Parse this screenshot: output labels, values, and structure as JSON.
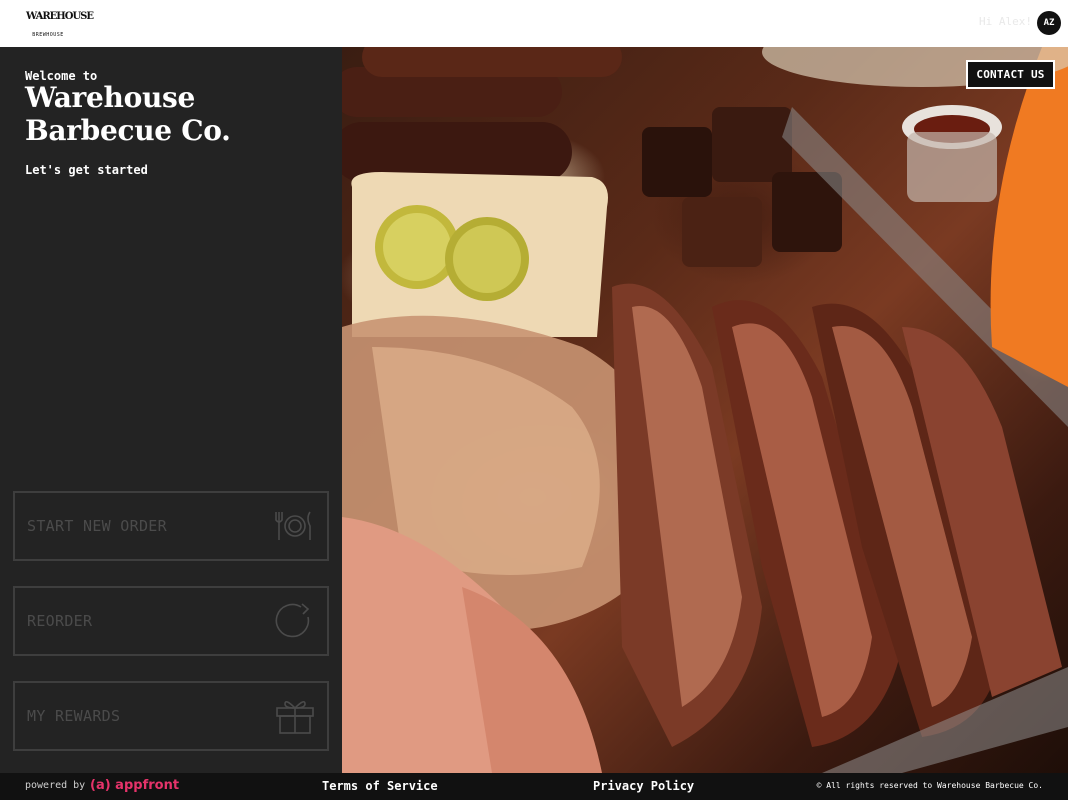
{
  "header": {
    "logo_text": "WAREHOUSE",
    "logo_subtext": "BREWHOUSE",
    "greeting": "Hi Alex!",
    "avatar_initials": "AZ"
  },
  "welcome": {
    "small": "Welcome to",
    "title": "Warehouse Barbecue Co.",
    "subtitle": "Let's get started"
  },
  "actions": [
    {
      "label": "START NEW ORDER",
      "icon": "fork-plate-knife-icon"
    },
    {
      "label": "REORDER",
      "icon": "refresh-icon"
    },
    {
      "label": "MY REWARDS",
      "icon": "gift-icon"
    }
  ],
  "contact": {
    "label": "CONTACT US"
  },
  "footer": {
    "powered_by": "powered by",
    "brand": "(a) appfront",
    "terms": "Terms of Service",
    "privacy": "Privacy Policy",
    "rights": "© All rights reserved to Warehouse Barbecue Co."
  },
  "colors": {
    "panel_bg": "#232323",
    "footer_bg": "#111111",
    "appfront_pink": "#e6336a",
    "muted_text": "#4b4b4b"
  }
}
